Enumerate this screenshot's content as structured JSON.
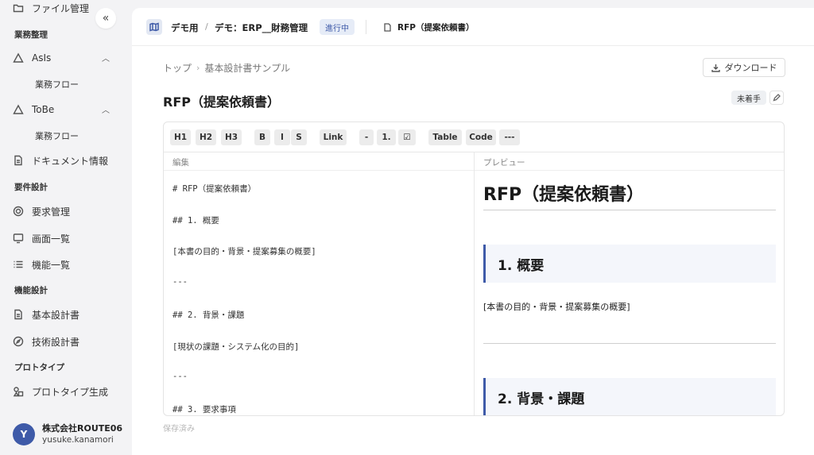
{
  "sidebar": {
    "file_mgmt": "ファイル管理",
    "sections": {
      "business": "業務整理",
      "requirements": "要件設計",
      "functional": "機能設計",
      "prototype": "プロトタイプ"
    },
    "asis": "AsIs",
    "asis_flow": "業務フロー",
    "tobe": "ToBe",
    "tobe_flow": "業務フロー",
    "document_info": "ドキュメント情報",
    "requirement_mgmt": "要求管理",
    "screen_list": "画面一覧",
    "function_list": "機能一覧",
    "basic_design": "基本設計書",
    "tech_design": "技術設計書",
    "prototype_gen": "プロトタイプ生成",
    "collapse_glyph": "«"
  },
  "user": {
    "initial": "Y",
    "org": "株式会社ROUTE06",
    "name": "yusuke.kanamori"
  },
  "topbar": {
    "crumb1": "デモ用",
    "sep": "/",
    "crumb2": "デモ：ERP__財務管理",
    "status": "進行中",
    "doc_tab": "RFP（提案依頼書）"
  },
  "breadcrumb": {
    "top": "トップ",
    "sep": "›",
    "current": "基本設計書サンプル"
  },
  "download_label": "ダウンロード",
  "page_title": "RFP（提案依頼書）",
  "state_badge": "未着手",
  "toolbar": [
    "H1",
    "H2",
    "H3",
    "B",
    "I",
    "S",
    "Link",
    "-",
    "1.",
    "☑",
    "Table",
    "Code",
    "---"
  ],
  "editor": {
    "edit_label": "編集",
    "preview_label": "プレビュー",
    "source_lines": [
      "# RFP（提案依頼書）",
      "## 1. 概要",
      "[本書の目的・背景・提案募集の概要]",
      "---",
      "## 2. 背景・課題",
      "[現状の課題・システム化の目的]",
      "---",
      "## 3. 要求事項"
    ],
    "preview": {
      "h1": "RFP（提案依頼書）",
      "h2_1": "1. 概要",
      "p1": "[本書の目的・背景・提案募集の概要]",
      "h2_2": "2. 背景・課題"
    }
  },
  "saved_status": "保存済み",
  "colors": {
    "accent": "#3e5aa8",
    "sidebar_bg": "#f3f3f5",
    "status_pill_bg": "#e6ecf7"
  }
}
